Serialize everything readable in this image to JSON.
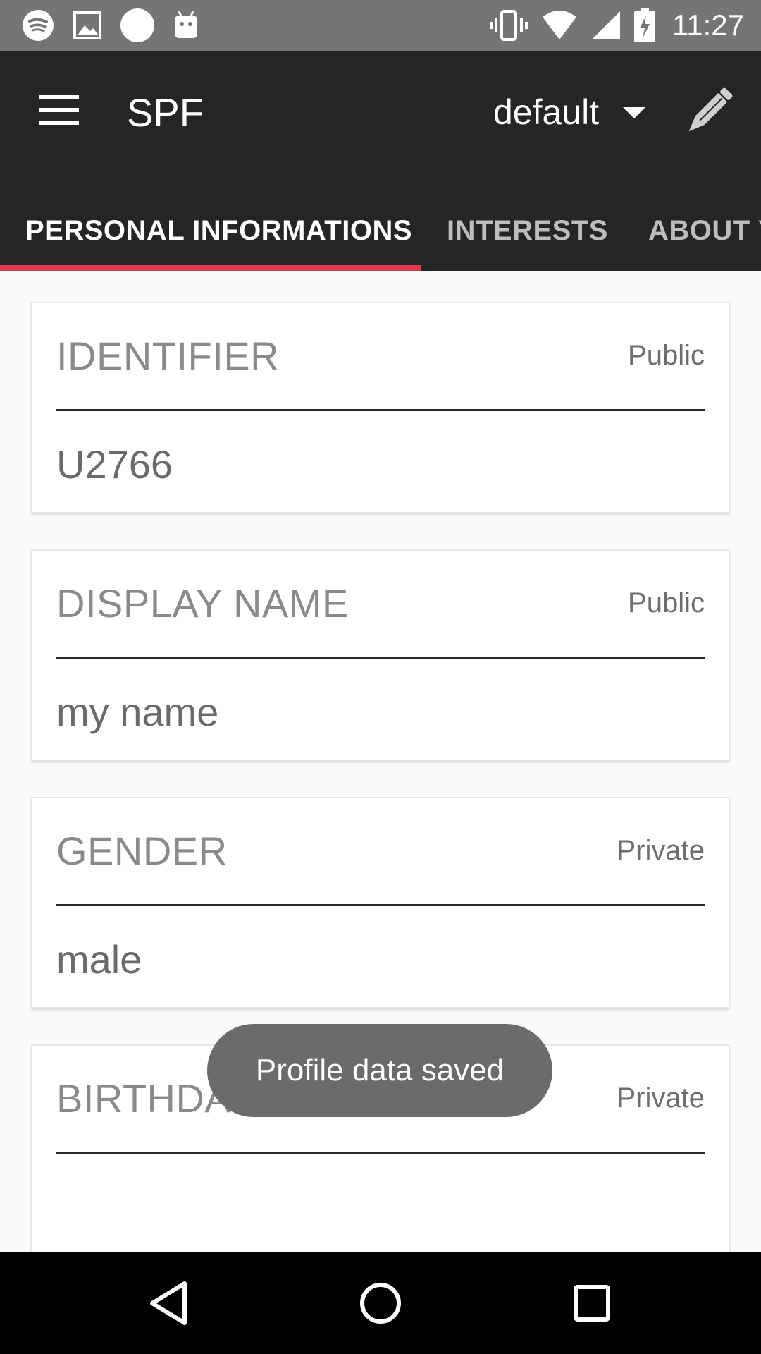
{
  "status_bar": {
    "time": "11:27",
    "left_icons": [
      "spotify-icon",
      "image-icon",
      "circle-icon",
      "android-icon"
    ],
    "right_icons": [
      "vibrate-icon",
      "wifi-icon",
      "signal-icon",
      "battery-charging-icon"
    ]
  },
  "app_bar": {
    "title": "SPF",
    "profile_selected": "default"
  },
  "tabs": [
    {
      "label": "PERSONAL INFORMATIONS",
      "active": true
    },
    {
      "label": "INTERESTS",
      "active": false
    },
    {
      "label": "ABOUT Y",
      "active": false
    }
  ],
  "fields": [
    {
      "label": "IDENTIFIER",
      "visibility": "Public",
      "value": "U2766"
    },
    {
      "label": "DISPLAY NAME",
      "visibility": "Public",
      "value": "my name"
    },
    {
      "label": "GENDER",
      "visibility": "Private",
      "value": "male"
    },
    {
      "label": "BIRTHDAY",
      "visibility": "Private",
      "value": ""
    }
  ],
  "toast": {
    "message": "Profile data saved"
  },
  "colors": {
    "status_bar_bg": "#757575",
    "app_bar_bg": "#252525",
    "tab_indicator": "#e53950",
    "toast_bg": "#6b6b6b"
  }
}
